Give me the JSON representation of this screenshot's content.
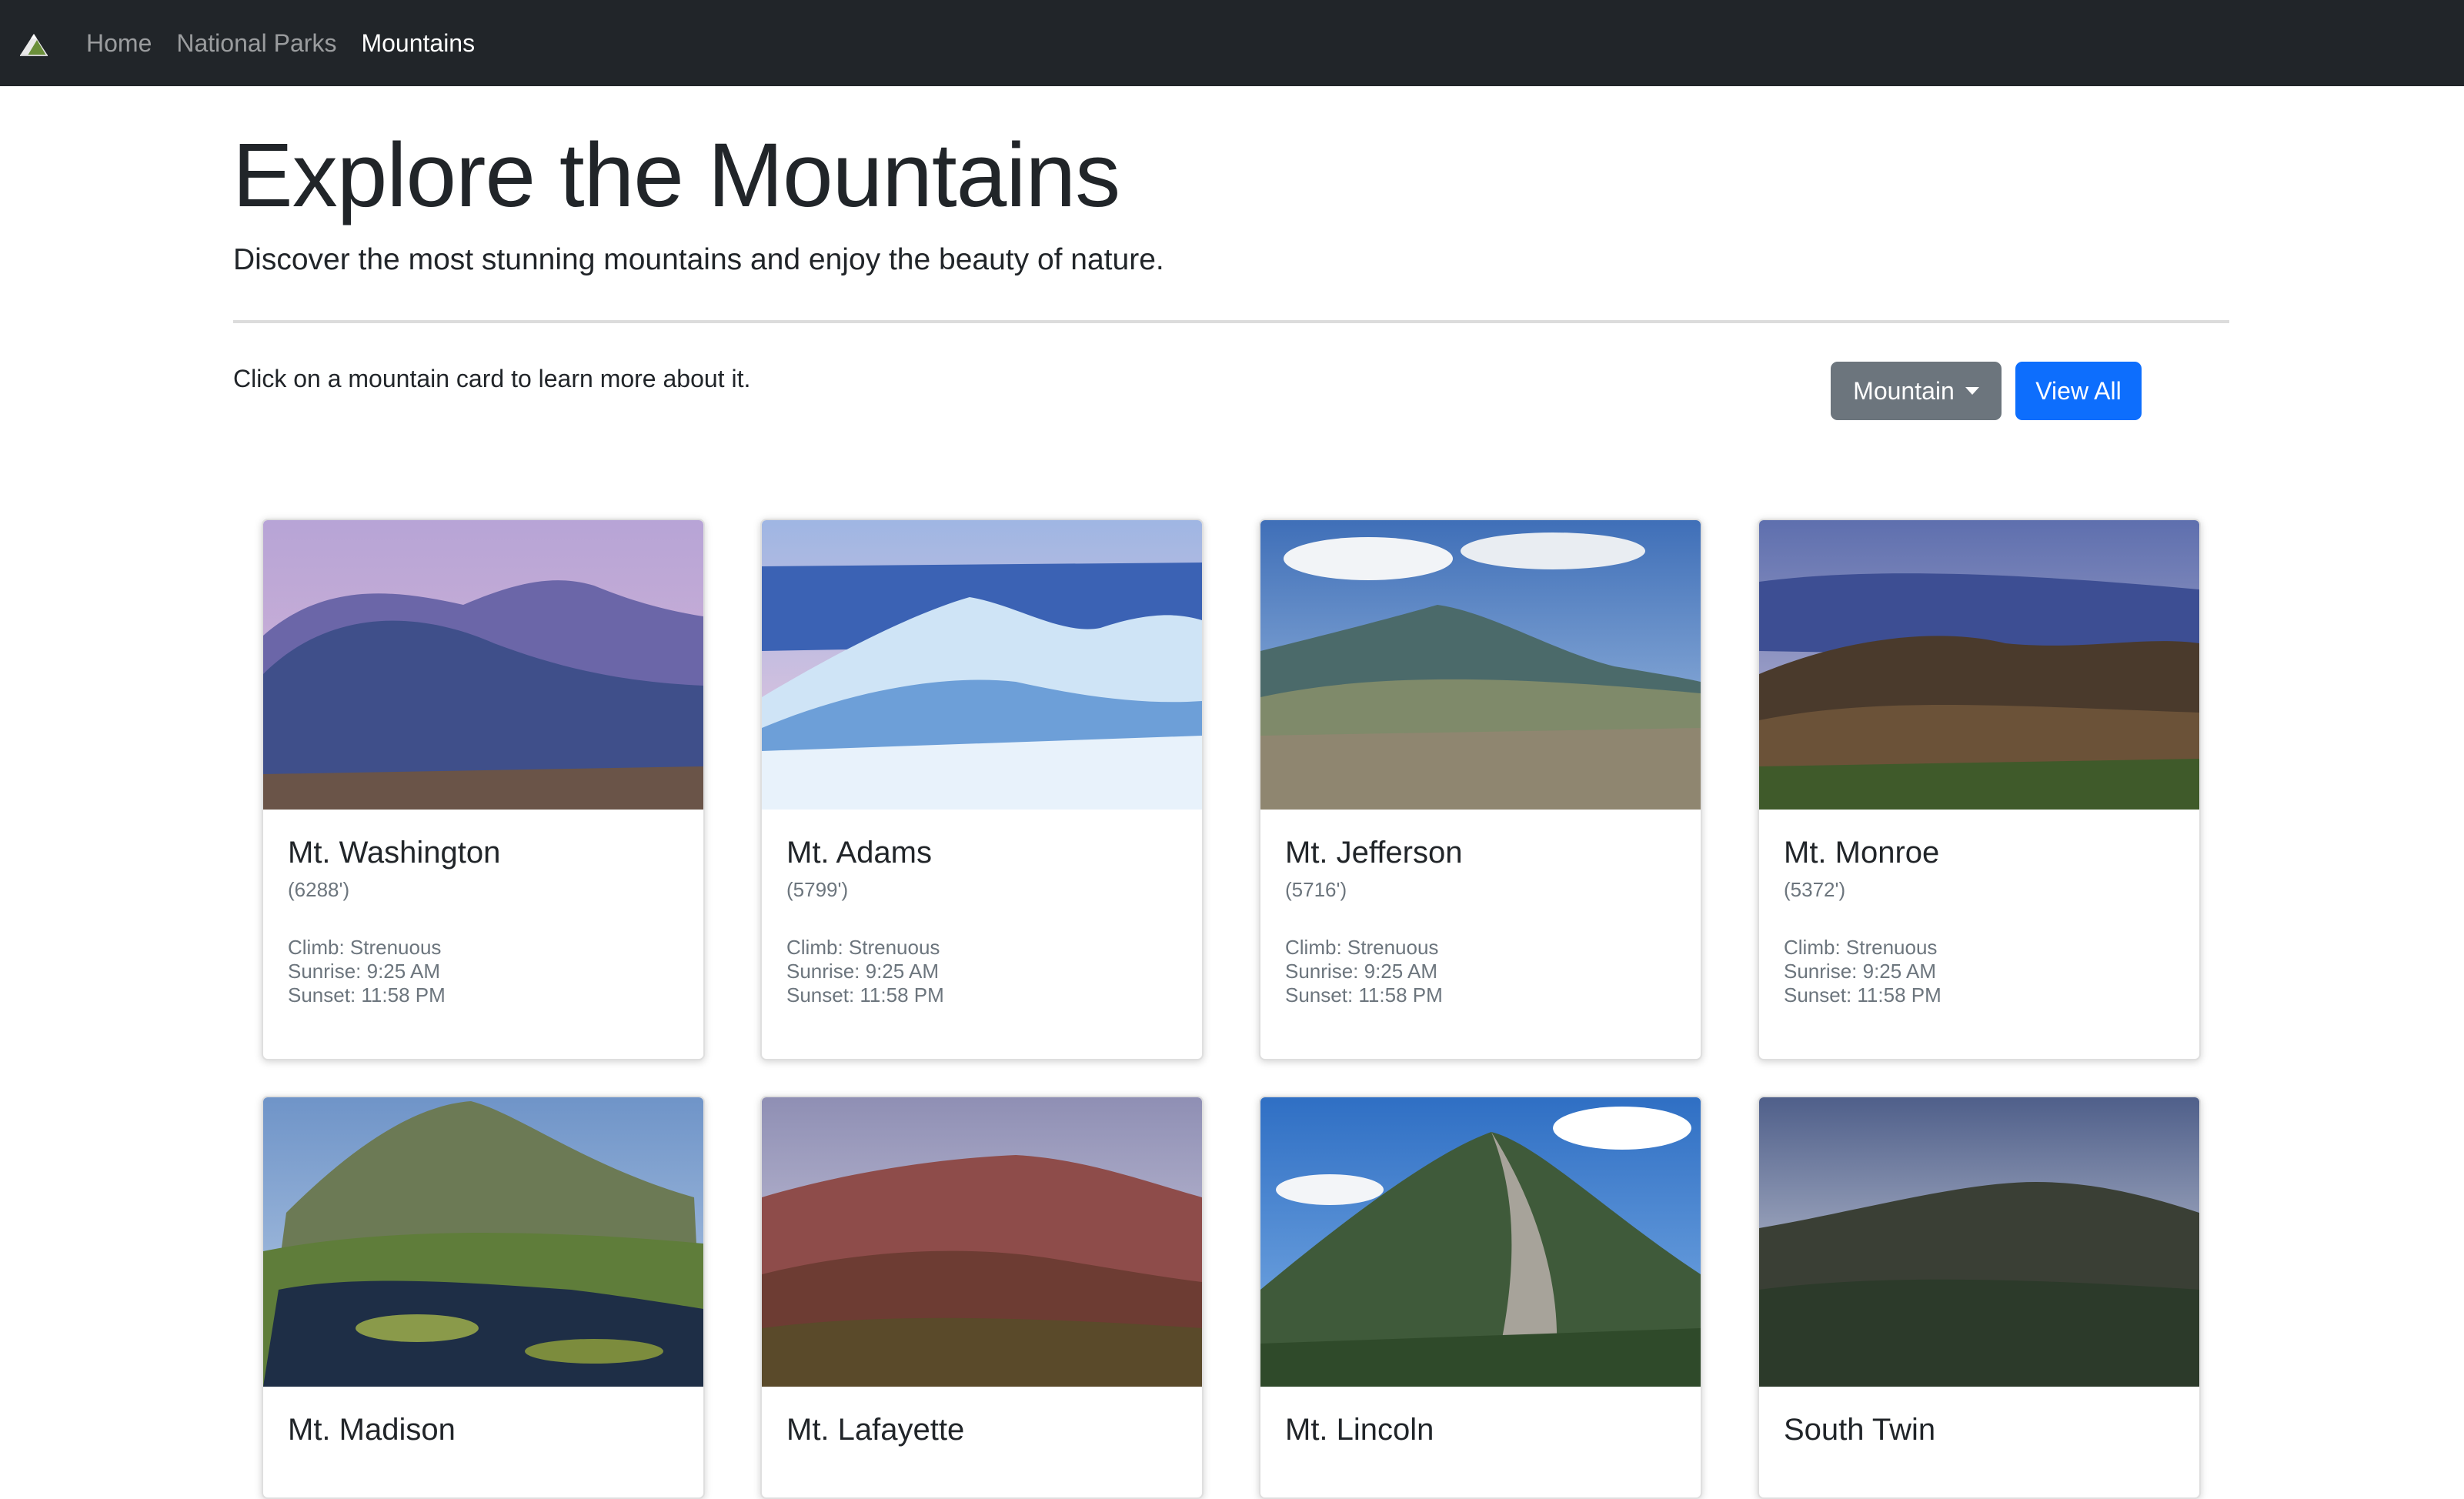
{
  "nav": {
    "links": [
      {
        "label": "Home"
      },
      {
        "label": "National Parks"
      },
      {
        "label": "Mountains"
      }
    ]
  },
  "hero": {
    "title": "Explore the Mountains",
    "subtitle": "Discover the most stunning mountains and enjoy the beauty of nature."
  },
  "instruction": "Click on a mountain card to learn more about it.",
  "controls": {
    "dropdown_label": "Mountain",
    "view_all_label": "View All"
  },
  "colors": {
    "navbar": "#212529",
    "secondary_button": "#6c757d",
    "primary_button": "#0d6efd"
  },
  "cards": [
    {
      "name": "Mt. Washington",
      "elevation": "(6288')",
      "climb": "Climb: Strenuous",
      "sunrise": "Sunrise: 9:25 AM",
      "sunset": "Sunset: 11:58 PM"
    },
    {
      "name": "Mt. Adams",
      "elevation": "(5799')",
      "climb": "Climb: Strenuous",
      "sunrise": "Sunrise: 9:25 AM",
      "sunset": "Sunset: 11:58 PM"
    },
    {
      "name": "Mt. Jefferson",
      "elevation": "(5716')",
      "climb": "Climb: Strenuous",
      "sunrise": "Sunrise: 9:25 AM",
      "sunset": "Sunset: 11:58 PM"
    },
    {
      "name": "Mt. Monroe",
      "elevation": "(5372')",
      "climb": "Climb: Strenuous",
      "sunrise": "Sunrise: 9:25 AM",
      "sunset": "Sunset: 11:58 PM"
    },
    {
      "name": "Mt. Madison"
    },
    {
      "name": "Mt. Lafayette"
    },
    {
      "name": "Mt. Lincoln"
    },
    {
      "name": "South Twin"
    }
  ]
}
